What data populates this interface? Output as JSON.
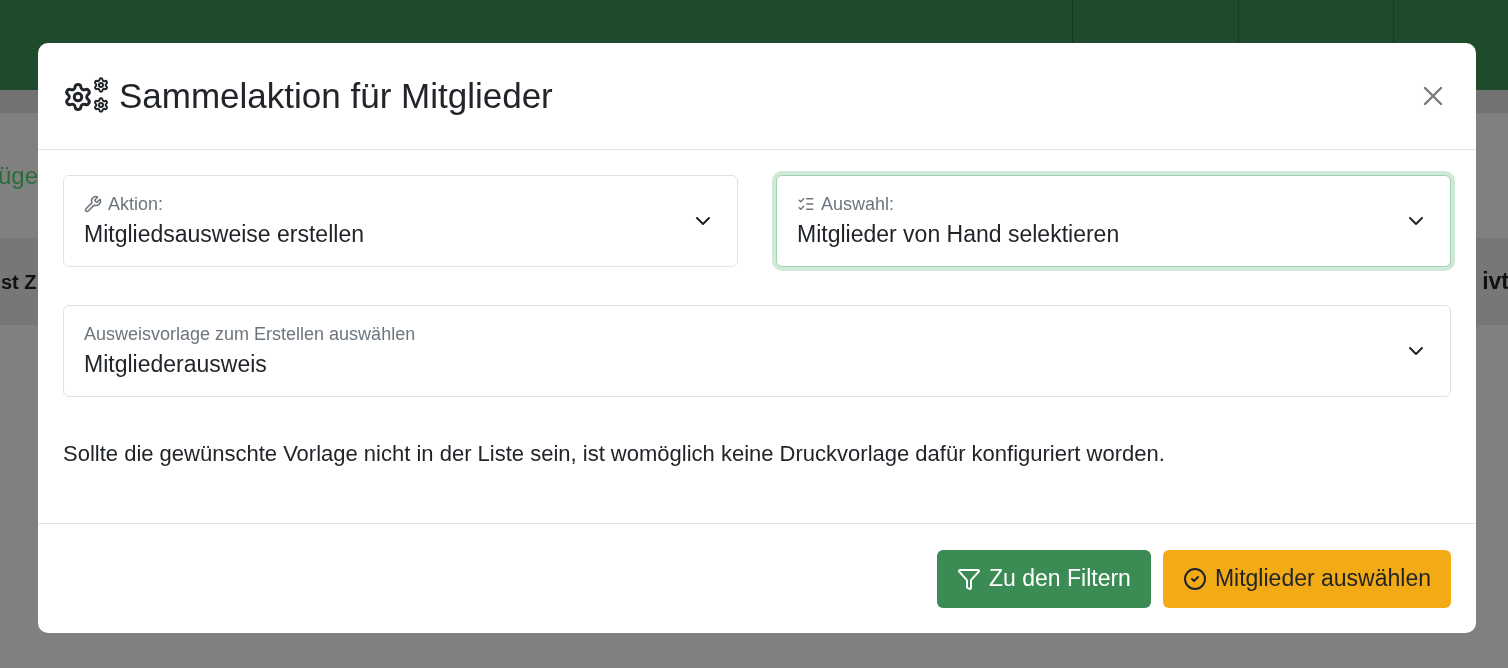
{
  "page": {
    "link": "üge",
    "table_headers": [
      "st Z",
      "ivt"
    ]
  },
  "modal": {
    "title": "Sammelaktion für Mitglieder",
    "fields": [
      {
        "kind": "action",
        "label": "Aktion:",
        "value": "Mitgliedsausweise erstellen",
        "focused": false
      },
      {
        "kind": "selection",
        "label": "Auswahl:",
        "value": "Mitglieder von Hand selektieren",
        "focused": true
      },
      {
        "kind": "plain",
        "label": "Ausweisvorlage zum Erstellen auswählen",
        "value": "Mitgliederausweis",
        "focused": false
      }
    ],
    "note": "Sollte die gewünschte Vorlage nicht in der Liste sein, ist womöglich keine Druckvorlage dafür konfiguriert worden.",
    "buttons": [
      {
        "kind": "filter",
        "label": "Zu den Filtern"
      },
      {
        "kind": "confirm",
        "label": "Mitglieder auswählen"
      }
    ]
  }
}
